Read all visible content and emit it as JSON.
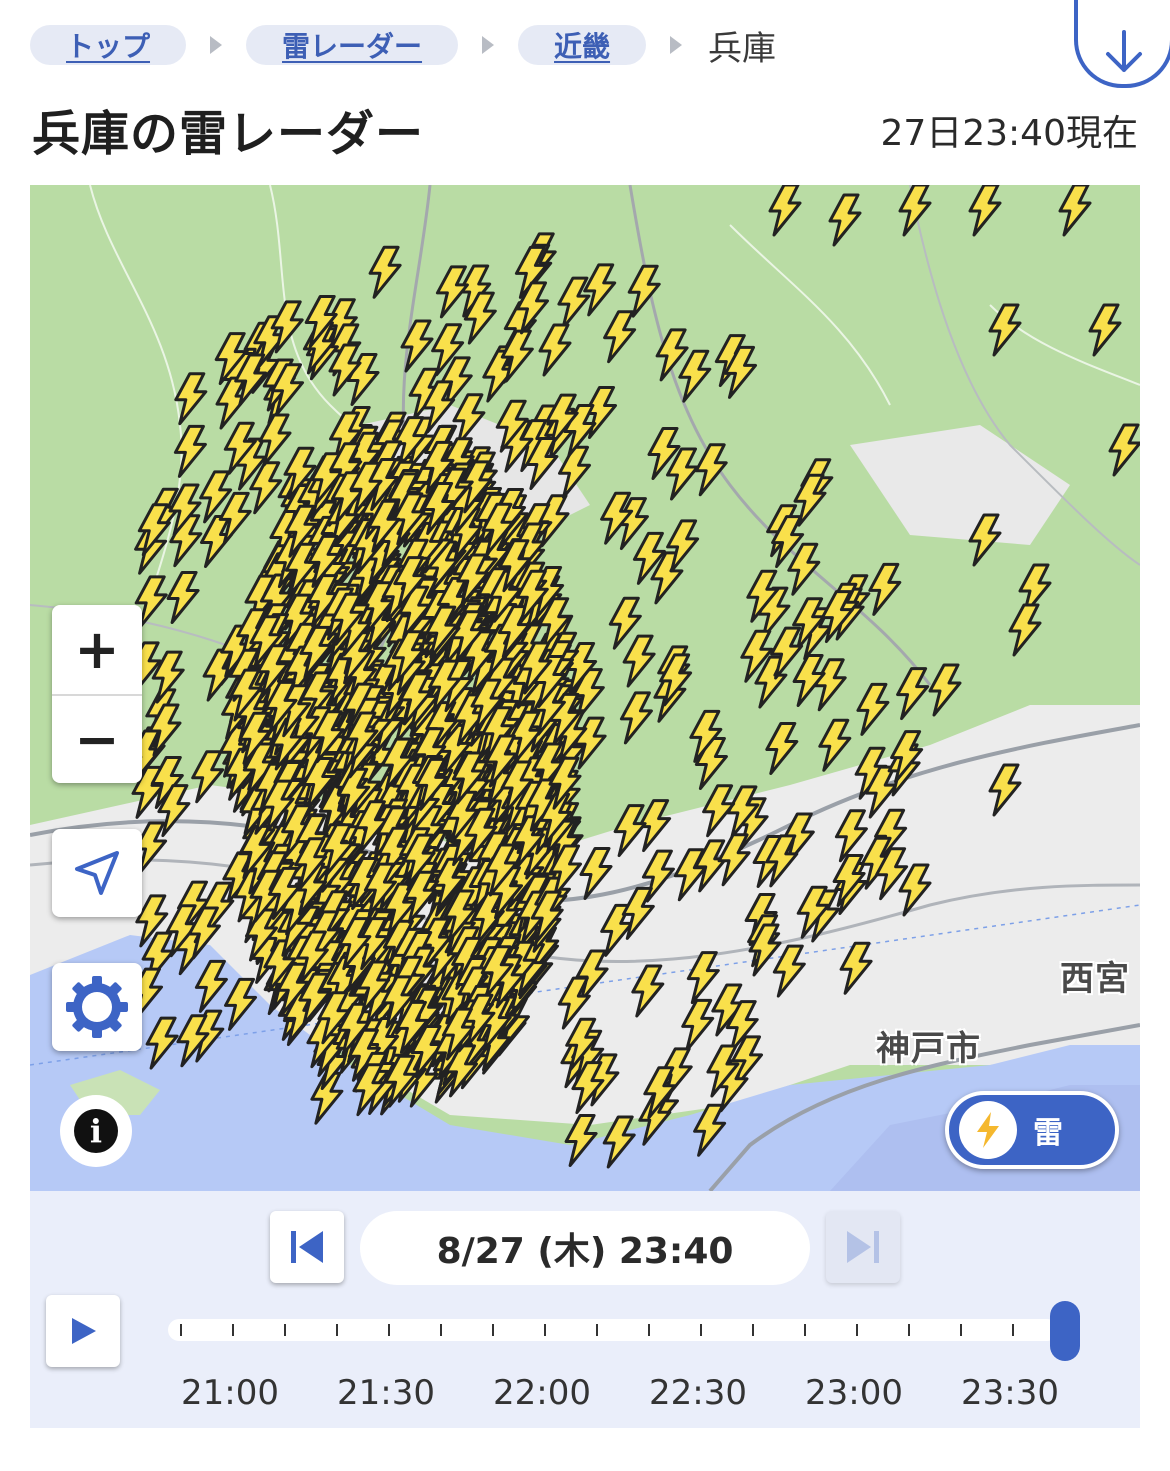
{
  "breadcrumb": {
    "items": [
      {
        "label": "トップ"
      },
      {
        "label": "雷レーダー"
      },
      {
        "label": "近畿"
      }
    ],
    "current": "兵庫"
  },
  "header": {
    "title": "兵庫の雷レーダー",
    "current_time": "27日23:40現在"
  },
  "map": {
    "place_labels": {
      "nishinomiya": "西宮",
      "kobe": "神戸市"
    },
    "layer_toggle": {
      "label": "雷",
      "icon": "lightning-icon"
    },
    "zoom_in_label": "+",
    "zoom_out_label": "−",
    "colors": {
      "land": "#b9dca4",
      "urban": "#ececec",
      "sea": "#b6c9f6",
      "bolt_fill": "#f9e04b",
      "bolt_stroke": "#222222",
      "accent": "#3d64c5"
    }
  },
  "timeline": {
    "current_datetime": "8/27 (木) 23:40",
    "tick_labels": [
      "21:00",
      "21:30",
      "22:00",
      "22:30",
      "23:00",
      "23:30"
    ],
    "position_fraction": 1.0
  }
}
